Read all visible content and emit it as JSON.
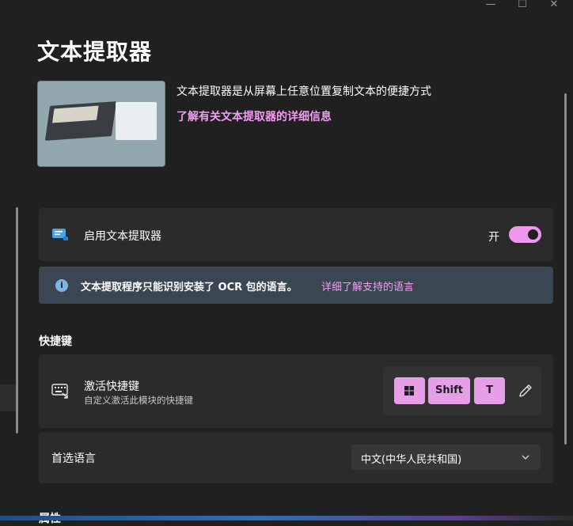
{
  "window": {
    "minimize_glyph": "—",
    "maximize_glyph": "☐",
    "close_glyph": "✕"
  },
  "page": {
    "title": "文本提取器",
    "description": "文本提取器是从屏幕上任意位置复制文本的便捷方式",
    "learn_more_link": "了解有关文本提取器的详细信息"
  },
  "enable": {
    "label": "启用文本提取器",
    "toggle_state_label": "开",
    "enabled": true,
    "icon": "text-extractor-icon"
  },
  "info_bar": {
    "message": "文本提取程序只能识别安装了 OCR 包的语言。",
    "link": "详细了解支持的语言",
    "icon": "info-icon"
  },
  "shortcuts": {
    "section_title": "快捷键",
    "activation": {
      "title": "激活快捷键",
      "description": "自定义激活此模块的快捷键",
      "keys": [
        "Win",
        "Shift",
        "T"
      ],
      "icon": "keyboard-icon"
    }
  },
  "language": {
    "label": "首选语言",
    "selected": "中文(中华人民共和国)"
  },
  "next_section_partial": "属性",
  "colors": {
    "accent": "#ee98ee",
    "background": "#202020",
    "card": "#2b2b2b",
    "info_bg": "#3a4752"
  }
}
